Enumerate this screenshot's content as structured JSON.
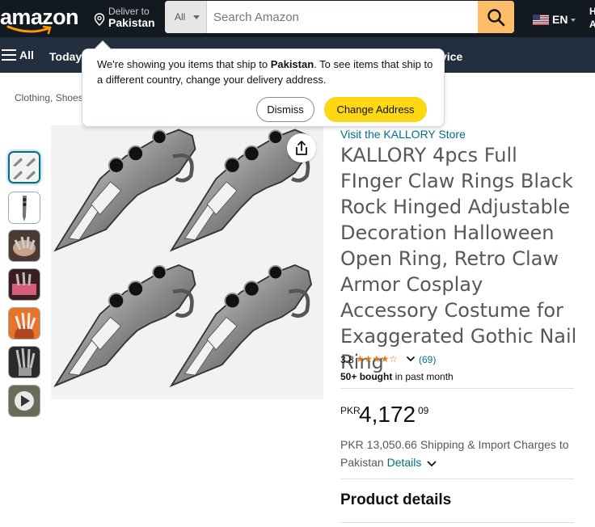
{
  "header": {
    "logo_text": "amazon",
    "deliver_line1": "Deliver to",
    "deliver_line2": "Pakistan",
    "search_category": "All",
    "search_placeholder": "Search Amazon",
    "lang_code": "EN",
    "edge_text": "H\nA"
  },
  "nav": {
    "all_label": "All",
    "items": [
      "Today's",
      "vice"
    ]
  },
  "breadcrumb": "Clothing, Shoes",
  "popover": {
    "msg_prefix": "We're showing you items that ship to ",
    "msg_country": "Pakistan",
    "msg_suffix": ". To see items that ship to a different country, change your delivery address.",
    "dismiss_label": "Dismiss",
    "change_label": "Change Address"
  },
  "product": {
    "store_link": "Visit the KALLORY Store",
    "title": "KALLORY 4pcs Full FInger Claw Rings Black Rock Hinged Adjustable Decoration Halloween Open Ring, Retro Claw Armor Cosplay Accessory Costume for Exaggerated Gothic Nail Ring",
    "rating": "3.8",
    "rating_value": 3.8,
    "stars": "★★★★☆",
    "review_count": "(69)",
    "bought_bold": "50+ bought",
    "bought_rest": " in past month",
    "price_currency": "PKR",
    "price_whole": "4,172",
    "price_fraction": "09",
    "shipping_text": "PKR 13,050.66 Shipping & Import Charges to Pakistan",
    "details_link": "Details",
    "product_details_heading": "Product details"
  },
  "thumbnails": [
    "ring-claws",
    "single-claw",
    "worn-hand",
    "pink-hand",
    "halloween-hand",
    "skeleton-hand",
    "video"
  ],
  "colors": {
    "nav_bg": "#131921",
    "subnav_bg": "#232f3e",
    "search_btn": "#febd69",
    "link": "#007185",
    "star": "#de7921",
    "change_btn": "#ffd814"
  }
}
